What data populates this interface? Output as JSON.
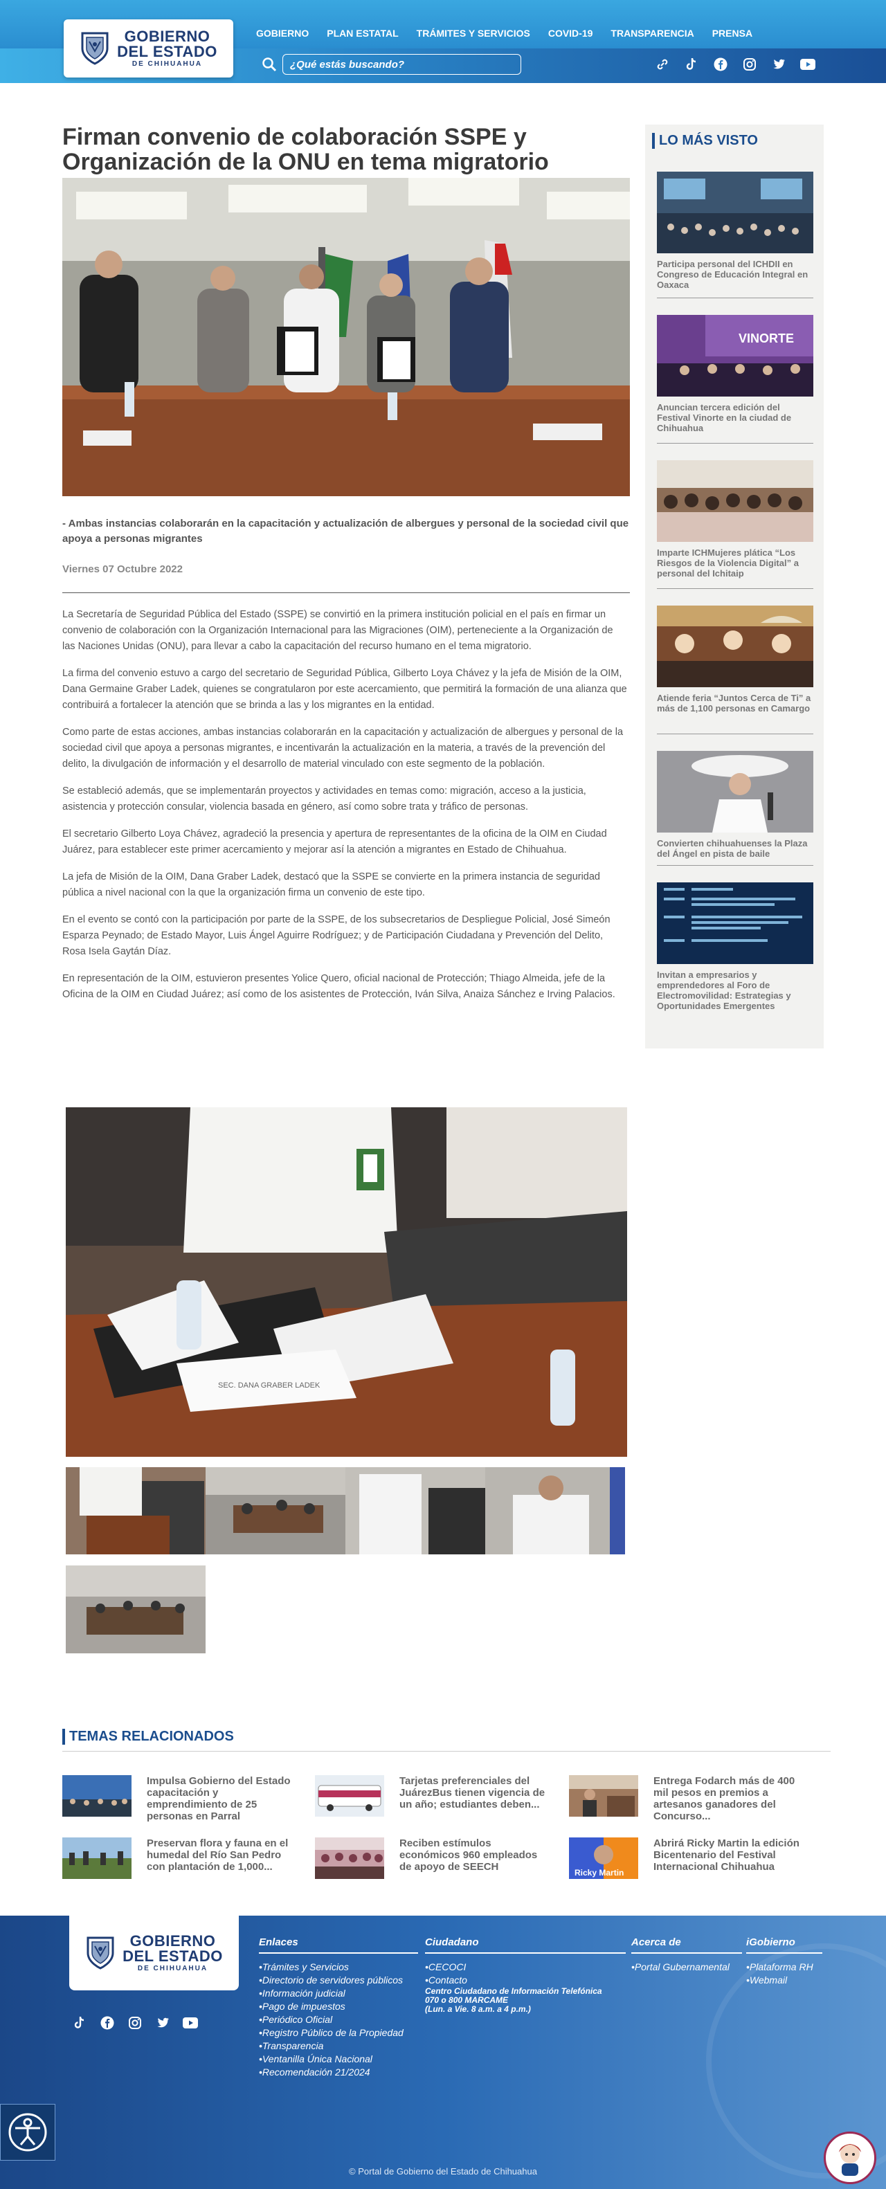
{
  "header": {
    "logo": {
      "line1": "GOBIERNO",
      "line2": "DEL ESTADO",
      "line3": "DE CHIHUAHUA"
    },
    "nav": [
      {
        "label": "GOBIERNO",
        "dropdown": true
      },
      {
        "label": "PLAN ESTATAL",
        "dropdown": true
      },
      {
        "label": "TRÁMITES Y SERVICIOS",
        "dropdown": false
      },
      {
        "label": "COVID-19",
        "dropdown": false
      },
      {
        "label": "TRANSPARENCIA",
        "dropdown": true
      },
      {
        "label": "PRENSA",
        "dropdown": false
      }
    ],
    "search_placeholder": "¿Qué estás buscando?",
    "social": [
      "link-icon",
      "tiktok-icon",
      "facebook-icon",
      "instagram-icon",
      "twitter-icon",
      "youtube-icon"
    ]
  },
  "article": {
    "title": "Firman convenio de colaboración SSPE y Organización de la ONU en tema migratorio",
    "summary": "- Ambas instancias colaborarán en la capacitación y actualización de albergues y personal de la sociedad civil que apoya a personas migrantes",
    "date": "Viernes 07 Octubre 2022",
    "paragraphs": [
      "La Secretaría de Seguridad Pública del Estado (SSPE) se convirtió en la primera institución policial en el país en firmar un convenio de colaboración con la Organización Internacional para las Migraciones (OIM), perteneciente a la Organización de las Naciones Unidas (ONU), para llevar a cabo la capacitación del recurso humano en el tema migratorio.",
      "La firma del convenio estuvo a cargo del secretario de Seguridad Pública, Gilberto Loya Chávez y la jefa de Misión de la OIM, Dana Germaine Graber Ladek, quienes se congratularon por este acercamiento, que permitirá la formación de una alianza que contribuirá a fortalecer la atención que se brinda a las y los migrantes en la entidad.",
      "Como parte de estas acciones, ambas instancias colaborarán en la capacitación y actualización de albergues y personal de la sociedad civil que apoya a personas migrantes, e incentivarán la actualización en la materia, a través de la prevención del delito, la divulgación de información y el desarrollo de material vinculado con este segmento de la población.",
      "Se estableció además, que se implementarán proyectos y actividades en temas como: migración, acceso a la justicia, asistencia y protección consular, violencia basada en género, así como sobre trata y tráfico de personas.",
      "El secretario Gilberto Loya Chávez, agradeció la presencia y apertura de  representantes de la oficina de la OIM en Ciudad Juárez, para establecer este primer acercamiento y mejorar así la atención a migrantes en Estado de Chihuahua.",
      "La jefa de Misión de la OIM, Dana Graber Ladek, destacó que la SSPE se convierte en la primera instancia de seguridad pública a nivel nacional con la que la organización firma un convenio de este tipo.",
      "En el evento se contó con la participación por parte de la SSPE, de los subsecretarios de Despliegue Policial, José Simeón Esparza Peynado; de Estado Mayor, Luis Ángel Aguirre Rodríguez; y de Participación Ciudadana y Prevención del Delito, Rosa Isela Gaytán Díaz.",
      "En representación de la OIM, estuvieron presentes Yolice Quero, oficial nacional de Protección; Thiago Almeida, jefe de la Oficina de la OIM en Ciudad Juárez; así como de los asistentes de Protección, Iván Silva, Anaiza Sánchez e Irving Palacios."
    ],
    "placard_text": "SEC. DANA GRABER LADEK"
  },
  "sidebar": {
    "title": "LO MÁS VISTO",
    "items": [
      {
        "caption": "Participa personal del ICHDII en Congreso de Educación Integral en Oaxaca"
      },
      {
        "caption": "Anuncian tercera edición del Festival Vinorte en la ciudad de Chihuahua",
        "banner": "VINORTE"
      },
      {
        "caption": "Imparte ICHMujeres plática “Los Riesgos de la Violencia Digital” a personal del Ichitaip"
      },
      {
        "caption": "Atiende feria “Juntos Cerca de Ti” a más de 1,100 personas en Camargo"
      },
      {
        "caption": "Convierten chihuahuenses la Plaza del Ángel en pista de baile"
      },
      {
        "caption": "Invitan a empresarios y emprendedores al Foro de Electromovilidad: Estrategias y Oportunidades Emergentes"
      }
    ]
  },
  "related": {
    "title": "TEMAS RELACIONADOS",
    "items": [
      {
        "text": "Impulsa Gobierno del Estado capacitación y emprendimiento de 25 personas en Parral"
      },
      {
        "text": "Tarjetas preferenciales del JuárezBus tienen vigencia de un año; estudiantes deben..."
      },
      {
        "text": "Entrega Fodarch más de 400 mil pesos en premios a artesanos ganadores del Concurso..."
      },
      {
        "text": "Preservan flora y fauna en el humedal del Río San Pedro con plantación de 1,000..."
      },
      {
        "text": "Reciben estímulos económicos 960 empleados de apoyo de SEECH"
      },
      {
        "text": "Abrirá Ricky Martin la edición Bicentenario del Festival Internacional Chihuahua",
        "img_label": "Ricky Martin"
      }
    ]
  },
  "footer": {
    "enlaces": {
      "title": "Enlaces",
      "items": [
        "•Trámites y Servicios",
        "•Directorio de servidores públicos",
        "•Información judicial",
        "•Pago de impuestos",
        "•Periódico Oficial",
        "•Registro Público de la Propiedad",
        "•Transparencia",
        "•Ventanilla Única Nacional",
        "•Recomendación 21/2024"
      ]
    },
    "ciudadano": {
      "title": "Ciudadano",
      "items": [
        "•CECOCI",
        "•Contacto"
      ],
      "call_center": [
        "Centro Ciudadano de Información Telefónica",
        "070 o 800 MARCAME",
        "(Lun. a Vie. 8 a.m. a 4 p.m.)"
      ]
    },
    "acerca": {
      "title": "Acerca de",
      "items": [
        "•Portal Gubernamental"
      ]
    },
    "igobierno": {
      "title": "iGobierno",
      "items": [
        "•Plataforma RH",
        "•Webmail"
      ]
    },
    "copyright": "© Portal de Gobierno del Estado de Chihuahua"
  },
  "colors": {
    "header_blue": "#2b8fd1",
    "title_blue": "#1b4d8d",
    "footer_dark": "#1b4788"
  }
}
